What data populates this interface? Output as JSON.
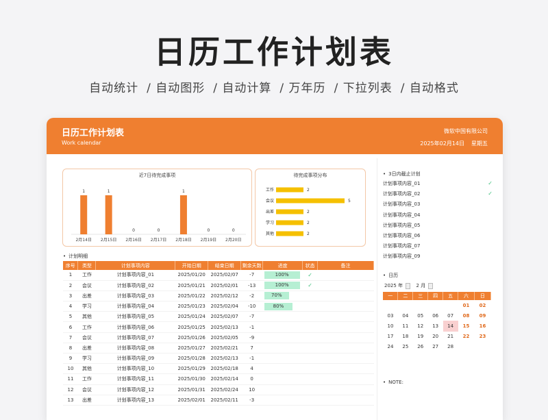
{
  "hero": {
    "title": "日历工作计划表",
    "features": [
      "自动统计",
      "/ 自动图形",
      "/ 自动计算",
      "/ 万年历",
      "/ 下拉列表",
      "/ 自动格式"
    ]
  },
  "header": {
    "title": "日历工作计划表",
    "subtitle": "Work calendar",
    "company": "微软中国有限公司",
    "date": "2025年02月14日",
    "weekday": "星期五"
  },
  "chart_data": [
    {
      "type": "bar",
      "title": "近7日待完成事项",
      "categories": [
        "2月14日",
        "2月15日",
        "2月16日",
        "2月17日",
        "2月18日",
        "2月19日",
        "2月20日"
      ],
      "values": [
        1,
        1,
        0,
        0,
        1,
        0,
        0
      ],
      "ylim": [
        0,
        1
      ],
      "color": "#ef7f30"
    },
    {
      "type": "bar",
      "orientation": "horizontal",
      "title": "待完成事项分布",
      "categories": [
        "工作",
        "会议",
        "出差",
        "学习",
        "其他"
      ],
      "values": [
        2,
        5,
        2,
        2,
        2
      ],
      "xlim": [
        0,
        5
      ],
      "color": "#f5c000"
    }
  ],
  "plan": {
    "label": "计划明细",
    "columns": [
      "序号",
      "类型",
      "计划事项内容",
      "开始日期",
      "结束日期",
      "剩余天数",
      "进度",
      "状态",
      "备注"
    ],
    "rows": [
      {
        "no": "1",
        "type": "工作",
        "content": "计划事项内容_01",
        "start": "2025/01/20",
        "end": "2025/02/07",
        "remain": "-7",
        "progress": "100%",
        "progress_value": 100,
        "status": "✓"
      },
      {
        "no": "2",
        "type": "会议",
        "content": "计划事项内容_02",
        "start": "2025/01/21",
        "end": "2025/02/01",
        "remain": "-13",
        "progress": "100%",
        "progress_value": 100,
        "status": "✓"
      },
      {
        "no": "3",
        "type": "出差",
        "content": "计划事项内容_03",
        "start": "2025/01/22",
        "end": "2025/02/12",
        "remain": "-2",
        "progress": "70%",
        "progress_value": 70,
        "status": ""
      },
      {
        "no": "4",
        "type": "学习",
        "content": "计划事项内容_04",
        "start": "2025/01/23",
        "end": "2025/02/04",
        "remain": "-10",
        "progress": "80%",
        "progress_value": 80,
        "status": ""
      },
      {
        "no": "5",
        "type": "其他",
        "content": "计划事项内容_05",
        "start": "2025/01/24",
        "end": "2025/02/07",
        "remain": "-7",
        "progress": "",
        "progress_value": 0,
        "status": ""
      },
      {
        "no": "6",
        "type": "工作",
        "content": "计划事项内容_06",
        "start": "2025/01/25",
        "end": "2025/02/13",
        "remain": "-1",
        "progress": "",
        "progress_value": 0,
        "status": ""
      },
      {
        "no": "7",
        "type": "会议",
        "content": "计划事项内容_07",
        "start": "2025/01/26",
        "end": "2025/02/05",
        "remain": "-9",
        "progress": "",
        "progress_value": 0,
        "status": ""
      },
      {
        "no": "8",
        "type": "出差",
        "content": "计划事项内容_08",
        "start": "2025/01/27",
        "end": "2025/02/21",
        "remain": "7",
        "progress": "",
        "progress_value": 0,
        "status": ""
      },
      {
        "no": "9",
        "type": "学习",
        "content": "计划事项内容_09",
        "start": "2025/01/28",
        "end": "2025/02/13",
        "remain": "-1",
        "progress": "",
        "progress_value": 0,
        "status": ""
      },
      {
        "no": "10",
        "type": "其他",
        "content": "计划事项内容_10",
        "start": "2025/01/29",
        "end": "2025/02/18",
        "remain": "4",
        "progress": "",
        "progress_value": 0,
        "status": ""
      },
      {
        "no": "11",
        "type": "工作",
        "content": "计划事项内容_11",
        "start": "2025/01/30",
        "end": "2025/02/14",
        "remain": "0",
        "progress": "",
        "progress_value": 0,
        "status": ""
      },
      {
        "no": "12",
        "type": "会议",
        "content": "计划事项内容_12",
        "start": "2025/01/31",
        "end": "2025/02/24",
        "remain": "10",
        "progress": "",
        "progress_value": 0,
        "status": ""
      },
      {
        "no": "13",
        "type": "出差",
        "content": "计划事项内容_13",
        "start": "2025/02/01",
        "end": "2025/02/11",
        "remain": "-3",
        "progress": "",
        "progress_value": 0,
        "status": ""
      }
    ]
  },
  "deadline": {
    "label": "3日内截止计划",
    "items": [
      {
        "text": "计划事项内容_01",
        "status": "✓"
      },
      {
        "text": "计划事项内容_02",
        "status": "✓"
      },
      {
        "text": "计划事项内容_03",
        "status": ""
      },
      {
        "text": "计划事项内容_04",
        "status": ""
      },
      {
        "text": "计划事项内容_05",
        "status": ""
      },
      {
        "text": "计划事项内容_06",
        "status": ""
      },
      {
        "text": "计划事项内容_07",
        "status": ""
      },
      {
        "text": "计划事项内容_09",
        "status": ""
      }
    ]
  },
  "calendar": {
    "label": "日历",
    "year": "2025",
    "year_unit": "年",
    "month": "2",
    "month_unit": "月",
    "weekdays": [
      "一",
      "二",
      "三",
      "四",
      "五",
      "六",
      "日"
    ],
    "weeks": [
      [
        "",
        "",
        "",
        "",
        "",
        "01",
        "02"
      ],
      [
        "03",
        "04",
        "05",
        "06",
        "07",
        "08",
        "09"
      ],
      [
        "10",
        "11",
        "12",
        "13",
        "14",
        "15",
        "16"
      ],
      [
        "17",
        "18",
        "19",
        "20",
        "21",
        "22",
        "23"
      ],
      [
        "24",
        "25",
        "26",
        "27",
        "28",
        "",
        ""
      ]
    ],
    "today": "14"
  },
  "note": {
    "label": "NOTE:"
  }
}
